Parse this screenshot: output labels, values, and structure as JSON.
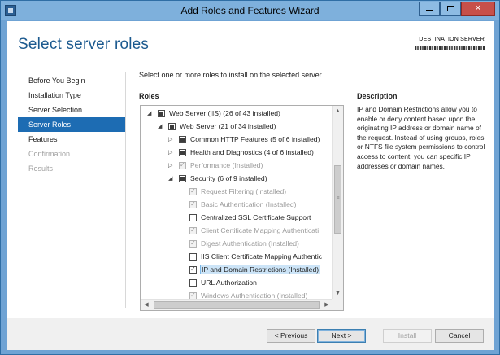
{
  "window": {
    "title": "Add Roles and Features Wizard",
    "controls": {
      "minimize": "minimize",
      "maximize": "maximize",
      "close": "✕"
    }
  },
  "header": {
    "page_title": "Select server roles",
    "destination_label": "DESTINATION SERVER"
  },
  "nav": {
    "items": [
      {
        "label": "Before You Begin",
        "state": "normal"
      },
      {
        "label": "Installation Type",
        "state": "normal"
      },
      {
        "label": "Server Selection",
        "state": "normal"
      },
      {
        "label": "Server Roles",
        "state": "active"
      },
      {
        "label": "Features",
        "state": "normal"
      },
      {
        "label": "Confirmation",
        "state": "disabled"
      },
      {
        "label": "Results",
        "state": "disabled"
      }
    ]
  },
  "main": {
    "instruction": "Select one or more roles to install on the selected server.",
    "roles_heading": "Roles",
    "tree": [
      {
        "label": "Web Server (IIS) (26 of 43 installed)",
        "expander": "expanded",
        "check": "partial",
        "disabled": false,
        "indent": 0
      },
      {
        "label": "Web Server (21 of 34 installed)",
        "expander": "expanded",
        "check": "partial",
        "disabled": false,
        "indent": 1
      },
      {
        "label": "Common HTTP Features (5 of 6 installed)",
        "expander": "collapsed",
        "check": "partial",
        "disabled": false,
        "indent": 2
      },
      {
        "label": "Health and Diagnostics (4 of 6 installed)",
        "expander": "collapsed",
        "check": "partial",
        "disabled": false,
        "indent": 2
      },
      {
        "label": "Performance (Installed)",
        "expander": "collapsed",
        "check": "checked",
        "disabled": true,
        "indent": 2
      },
      {
        "label": "Security (6 of 9 installed)",
        "expander": "expanded",
        "check": "partial",
        "disabled": false,
        "indent": 2
      },
      {
        "label": "Request Filtering (Installed)",
        "expander": "none",
        "check": "checked",
        "disabled": true,
        "indent": 3
      },
      {
        "label": "Basic Authentication (Installed)",
        "expander": "none",
        "check": "checked",
        "disabled": true,
        "indent": 3
      },
      {
        "label": "Centralized SSL Certificate Support",
        "expander": "none",
        "check": "unchecked",
        "disabled": false,
        "indent": 3
      },
      {
        "label": "Client Certificate Mapping Authenticati",
        "expander": "none",
        "check": "checked",
        "disabled": true,
        "indent": 3
      },
      {
        "label": "Digest Authentication (Installed)",
        "expander": "none",
        "check": "checked",
        "disabled": true,
        "indent": 3
      },
      {
        "label": "IIS Client Certificate Mapping Authentic",
        "expander": "none",
        "check": "unchecked",
        "disabled": false,
        "indent": 3
      },
      {
        "label": "IP and Domain Restrictions (Installed)",
        "expander": "none",
        "check": "checked",
        "disabled": false,
        "indent": 3,
        "selected": true
      },
      {
        "label": "URL Authorization",
        "expander": "none",
        "check": "unchecked",
        "disabled": false,
        "indent": 3
      },
      {
        "label": "Windows Authentication (Installed)",
        "expander": "none",
        "check": "checked",
        "disabled": true,
        "indent": 3
      }
    ],
    "scroll_position": 0.47,
    "icons": {
      "expanded": "triangle-down-icon",
      "collapsed": "triangle-right-icon",
      "scroll_up": "arrow-up-icon",
      "scroll_down": "arrow-down-icon",
      "scroll_left": "arrow-left-icon",
      "scroll_right": "arrow-right-icon",
      "grip": "scroll-grip-icon"
    }
  },
  "description": {
    "heading": "Description",
    "text": "IP and Domain Restrictions allow you to enable or deny content based upon the originating IP address or domain name of the request. Instead of using groups, roles, or NTFS file system permissions to control access to content, you can specific IP addresses or domain names."
  },
  "footer": {
    "previous_label": "< Previous",
    "next_label": "Next >",
    "install_label": "Install",
    "cancel_label": "Cancel"
  },
  "colors": {
    "accent": "#1d6cb3",
    "title": "#1c5a8f",
    "frame": "#6fa3d4",
    "close": "#c7504a"
  }
}
